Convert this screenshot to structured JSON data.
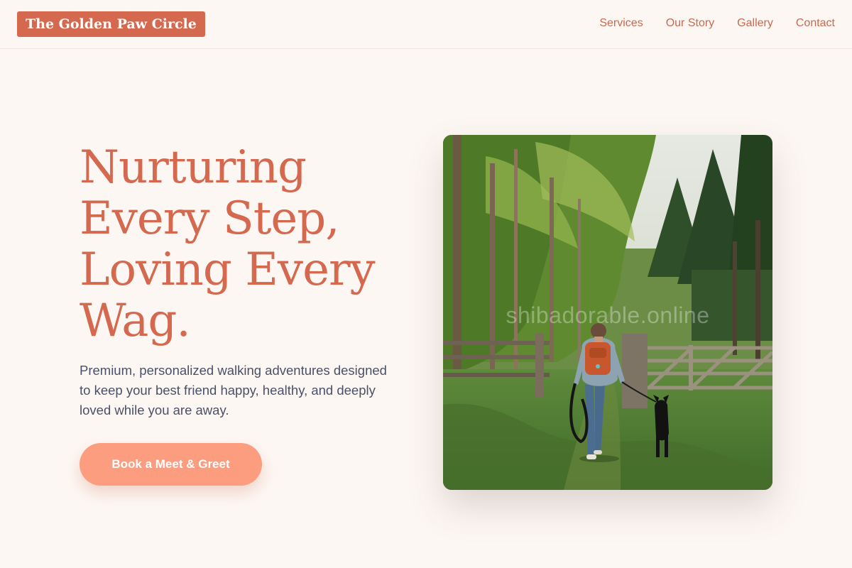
{
  "header": {
    "brand": "The Golden Paw Circle",
    "nav": [
      "Services",
      "Our Story",
      "Gallery",
      "Contact"
    ]
  },
  "hero": {
    "title_lines": [
      "Nurturing",
      "Every Step,",
      "Loving Every",
      "Wag."
    ],
    "subtitle": "Premium, personalized walking adventures designed to keep your best friend happy, healthy, and deeply loved while you are away.",
    "cta_label": "Book a Meet & Greet",
    "image": {
      "subject": "person with orange backpack walking a black dog on a grassy forest path beside a wooden fence",
      "watermark": "shibadorable.online"
    }
  },
  "colors": {
    "background": "#fdf7f3",
    "accent": "#d4694f",
    "cta": "#fb9d7e",
    "body_text": "#4a5166"
  }
}
